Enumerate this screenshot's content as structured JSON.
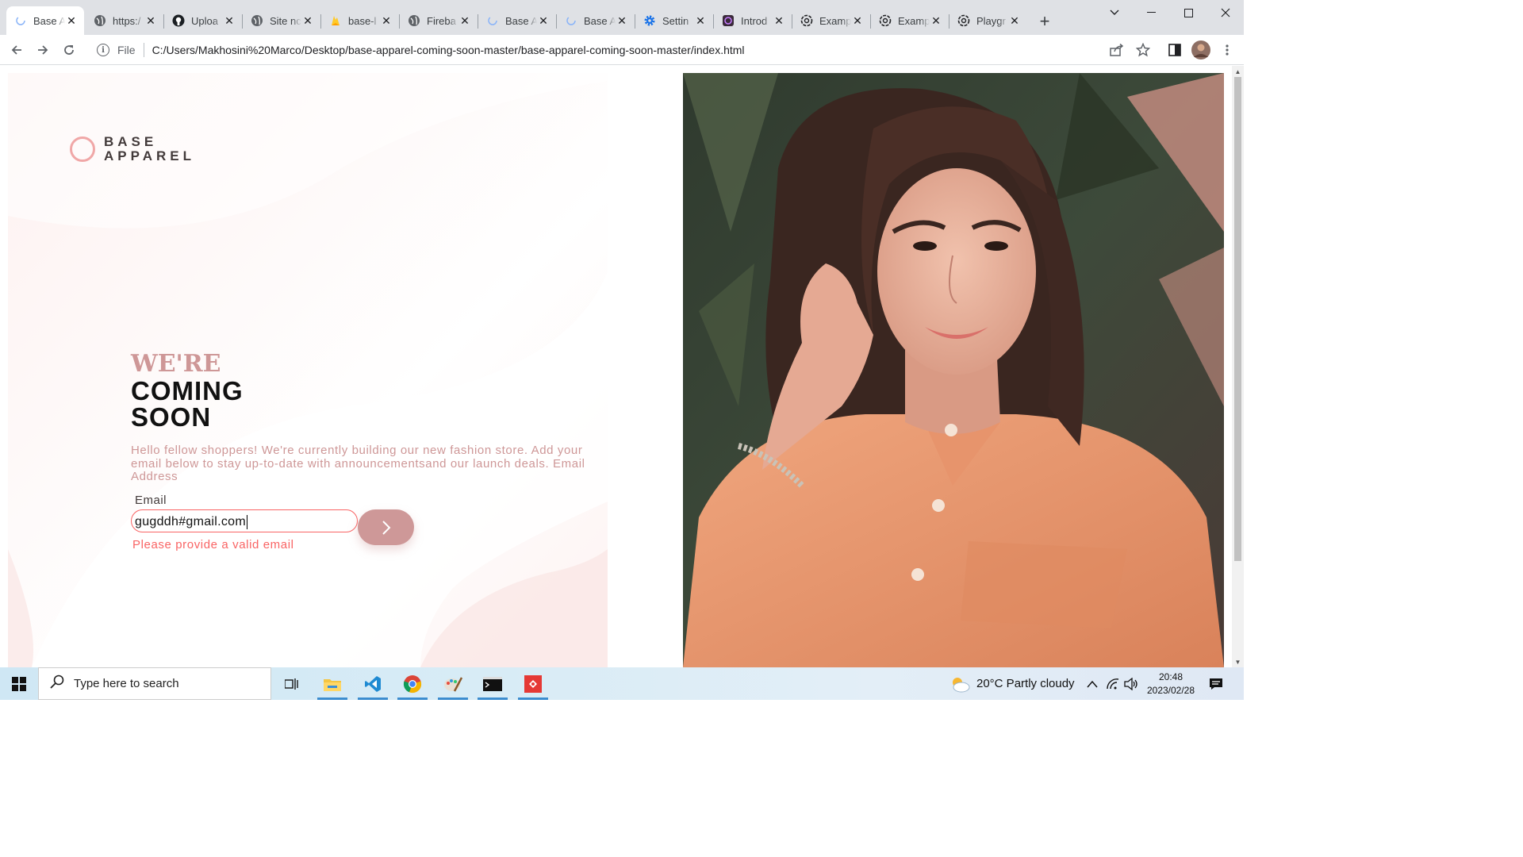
{
  "browser": {
    "tabs": [
      {
        "title": "Base A",
        "icon": "page-icon",
        "active": true
      },
      {
        "title": "https:/",
        "icon": "globe-icon"
      },
      {
        "title": "Uploa",
        "icon": "github-icon"
      },
      {
        "title": "Site nc",
        "icon": "globe-icon"
      },
      {
        "title": "base-l",
        "icon": "firebase-icon"
      },
      {
        "title": "Fireba",
        "icon": "globe-icon"
      },
      {
        "title": "Base A",
        "icon": "page-icon"
      },
      {
        "title": "Base A",
        "icon": "page-icon"
      },
      {
        "title": "Settin",
        "icon": "gear-icon"
      },
      {
        "title": "Introd",
        "icon": "docs-icon"
      },
      {
        "title": "Examp",
        "icon": "openai-icon"
      },
      {
        "title": "Examp",
        "icon": "openai-icon"
      },
      {
        "title": "Playgr",
        "icon": "openai-icon"
      }
    ],
    "address": {
      "scheme_label": "File",
      "url": "C:/Users/Makhosini%20Marco/Desktop/base-apparel-coming-soon-master/base-apparel-coming-soon-master/index.html"
    }
  },
  "page": {
    "logo": {
      "line1": "BASE",
      "line2": "APPAREL"
    },
    "headline": {
      "line1": "WE'RE",
      "line2": "COMING",
      "line3": "SOON"
    },
    "description": "Hello fellow shoppers! We're currently building our new fashion store. Add your email below to stay up-to-date with announcementsand our launch deals. Email Address",
    "email_label": "Email",
    "email_value": "gugddh#gmail.com",
    "error_message": "Please provide a valid email",
    "colors": {
      "accent": "#ce9797",
      "error": "#f96464",
      "dark": "#423a3a"
    }
  },
  "taskbar": {
    "search_placeholder": "Type here to search",
    "weather": "20°C  Partly cloudy",
    "time": "20:48",
    "date": "2023/02/28",
    "apps": [
      "task-view-icon",
      "file-explorer-icon",
      "vscode-icon",
      "chrome-icon",
      "paint-icon",
      "terminal-icon",
      "git-icon"
    ]
  }
}
